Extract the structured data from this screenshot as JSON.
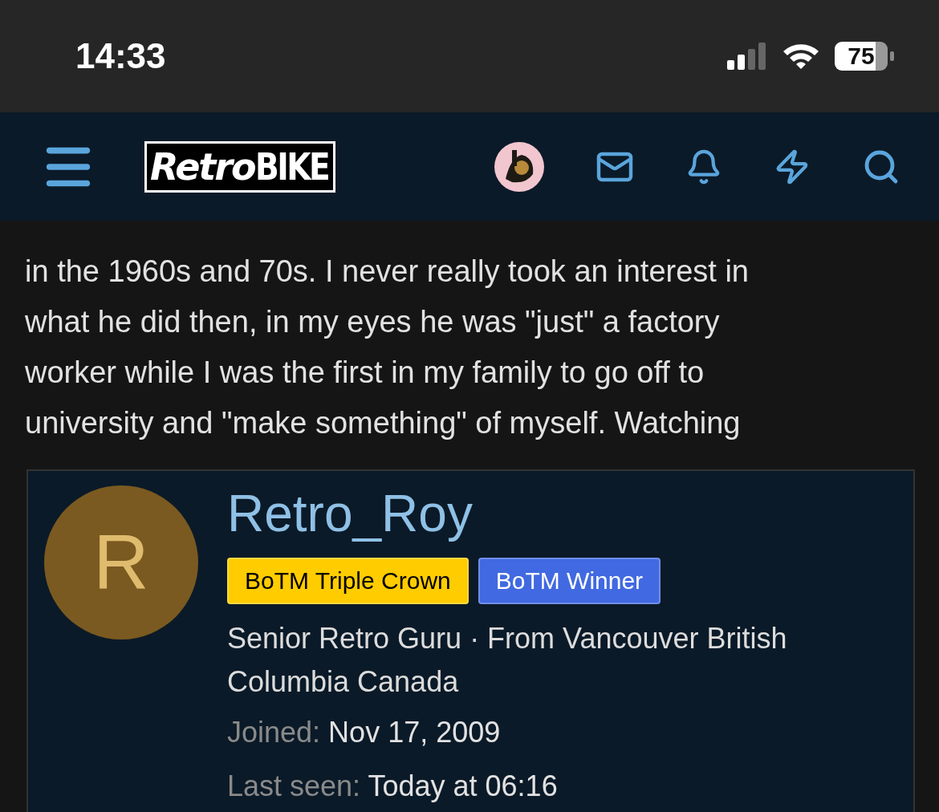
{
  "status_bar": {
    "time": "14:33",
    "battery": "75"
  },
  "header": {
    "logo": {
      "part_1": "Retro",
      "part_2": "BIKE"
    }
  },
  "post": {
    "lines": [
      "in the 1960s and 70s. I never really took an interest in",
      "what he did then, in my eyes he was \"just\" a factory",
      "worker while I was the first in my family to go off to",
      "university and \"make something\" of myself. Watching"
    ]
  },
  "member_card": {
    "initial": "R",
    "name": "Retro_Roy",
    "badges": [
      {
        "label": "BoTM Triple Crown",
        "color": "#ffcc00"
      },
      {
        "label": "BoTM Winner",
        "color": "#4169e1"
      }
    ],
    "title": "Senior Retro Guru · From Vancouver British Columbia Canada",
    "facts": [
      {
        "label": "Joined:",
        "value": "Nov 17, 2009"
      },
      {
        "label": "Last seen:",
        "value": "Today at 06:16"
      }
    ]
  }
}
